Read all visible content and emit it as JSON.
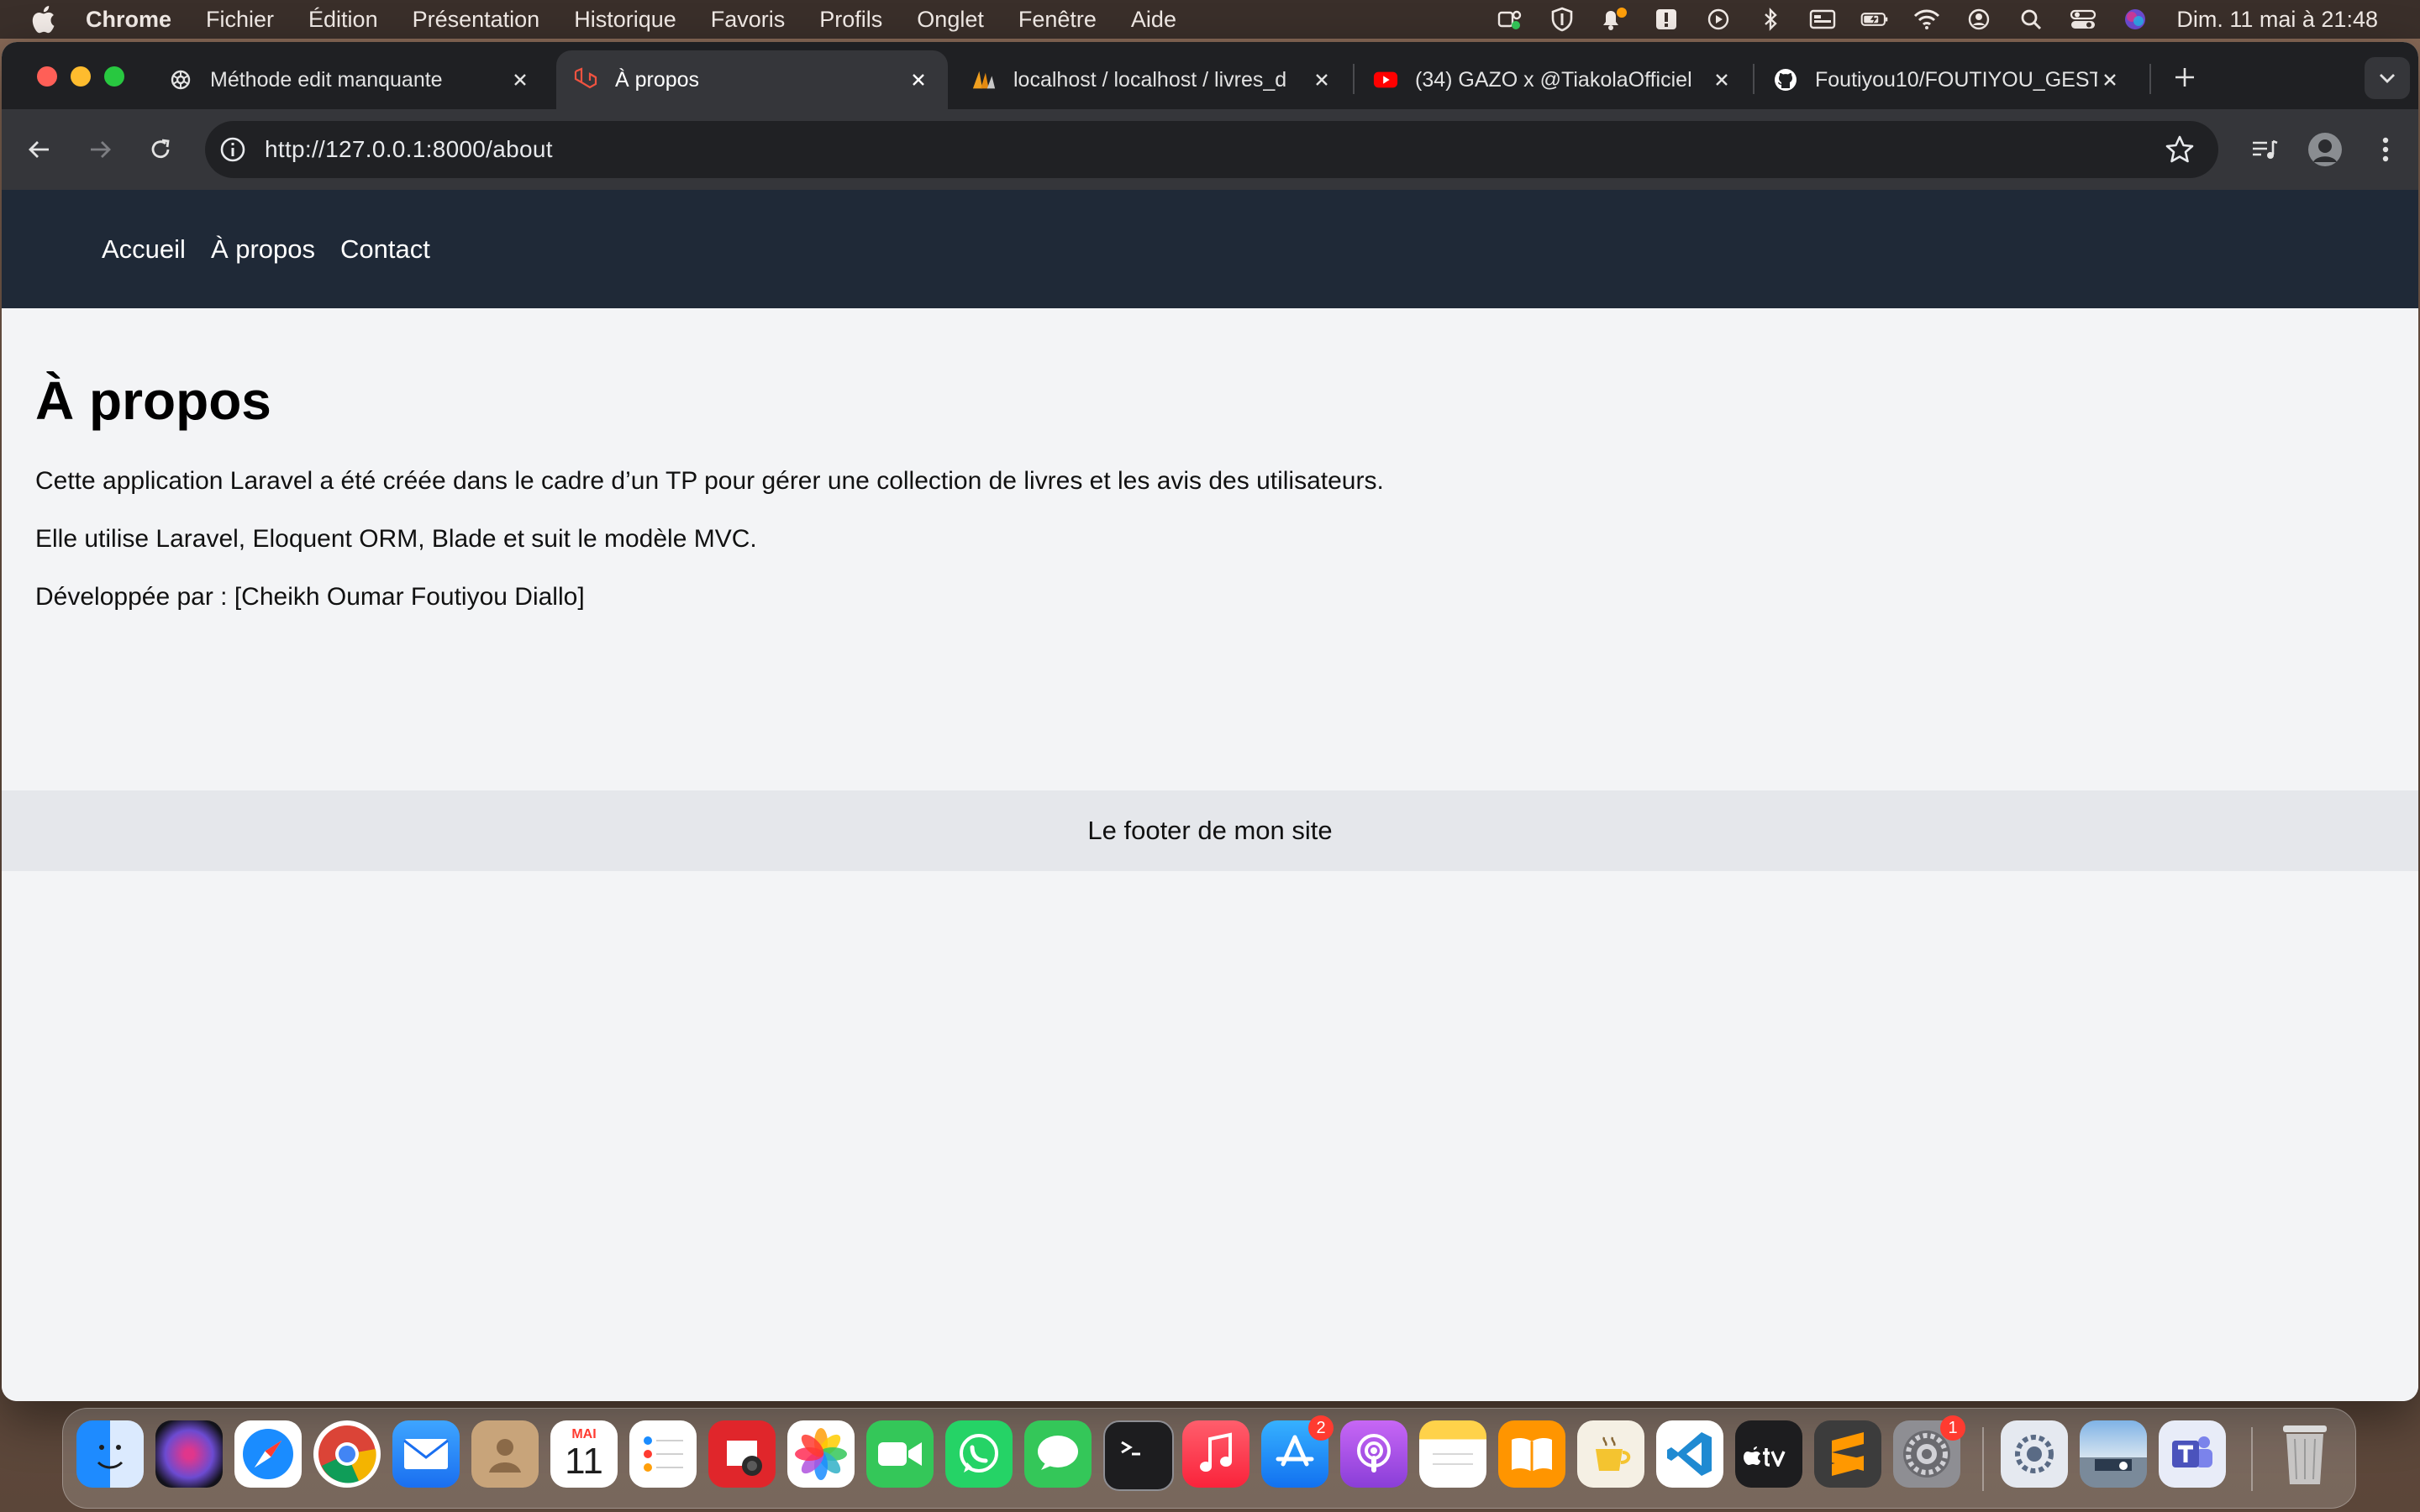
{
  "menubar": {
    "app_name": "Chrome",
    "menus": [
      "Fichier",
      "Édition",
      "Présentation",
      "Historique",
      "Favoris",
      "Profils",
      "Onglet",
      "Fenêtre",
      "Aide"
    ],
    "clock": "Dim. 11 mai à  21:48"
  },
  "tabs": [
    {
      "title": "Méthode edit manquante",
      "active": false
    },
    {
      "title": "À propos",
      "active": true
    },
    {
      "title": "localhost / localhost / livres_d",
      "active": false
    },
    {
      "title": "(34) GAZO x @TiakolaOfficiel",
      "active": false
    },
    {
      "title": "Foutiyou10/FOUTIYOU_GESTI",
      "active": false
    }
  ],
  "address_bar": {
    "url": "http://127.0.0.1:8000/about"
  },
  "site": {
    "nav": [
      "Accueil",
      "À propos",
      "Contact"
    ],
    "heading": "À propos",
    "paragraphs": [
      "Cette application Laravel a été créée dans le cadre d’un TP pour gérer une collection de livres et les avis des utilisateurs.",
      "Elle utilise Laravel, Eloquent ORM, Blade et suit le modèle MVC.",
      "Développée par : [Cheikh Oumar Foutiyou Diallo]"
    ],
    "footer": "Le footer de mon site"
  },
  "dock": {
    "calendar_month": "MAI",
    "calendar_day": "11",
    "badges": {
      "app_store": "2",
      "system_settings": "1"
    },
    "apps": [
      "finder-icon",
      "siri-icon",
      "safari-icon",
      "chrome-icon",
      "mail-icon",
      "contacts-icon",
      "calendar-icon",
      "reminders-icon",
      "photo-booth-icon",
      "photos-icon",
      "facetime-icon",
      "whatsapp-icon",
      "messages-icon",
      "terminal-icon",
      "music-icon",
      "app-store-icon",
      "podcasts-icon",
      "notes-icon",
      "books-icon",
      "tea-app-icon",
      "vscode-icon",
      "apple-tv-icon",
      "sublime-text-icon",
      "system-settings-icon",
      "utility-icon",
      "preview-icon",
      "teams-icon",
      "trash-icon"
    ]
  },
  "colors": {
    "site_nav_bg": "#1f2937",
    "page_bg": "#f3f4f6",
    "footer_bg": "#e5e7eb"
  }
}
